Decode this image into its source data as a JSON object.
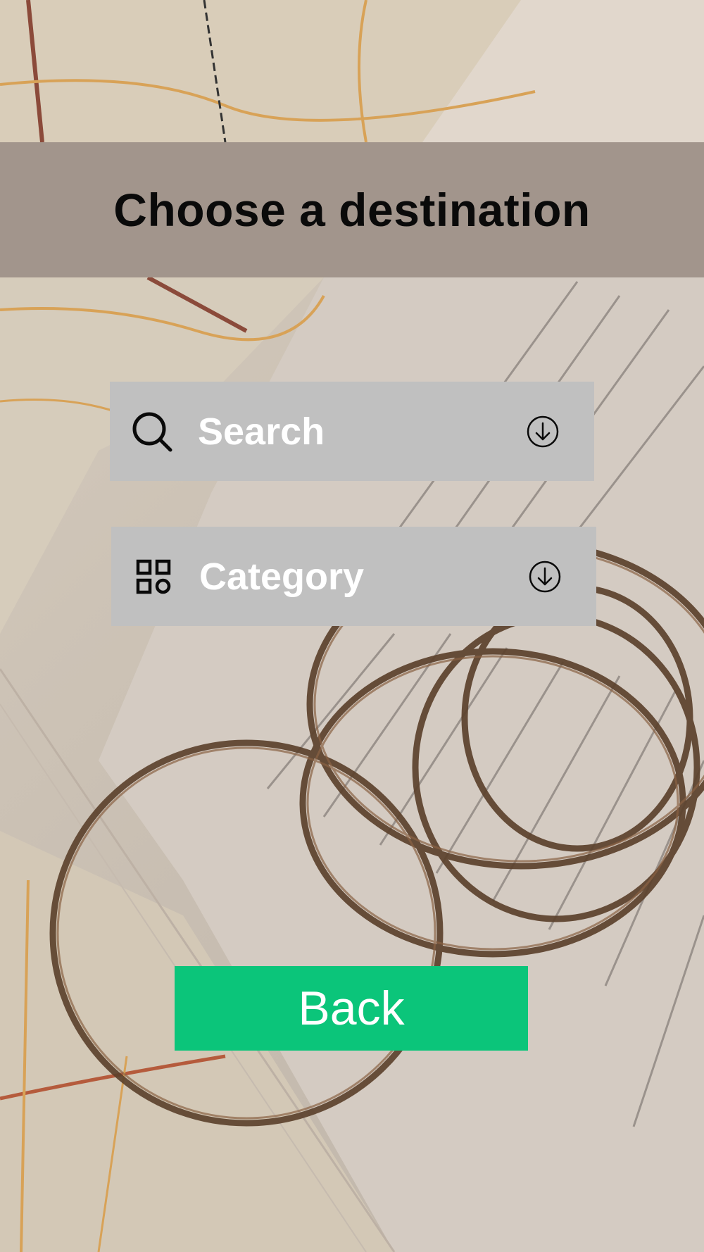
{
  "header": {
    "title": "Choose a destination"
  },
  "search": {
    "label": "Search",
    "lead_icon": "search-icon",
    "trail_icon": "arrow-down-circle-icon"
  },
  "category": {
    "label": "Category",
    "lead_icon": "category-grid-icon",
    "trail_icon": "arrow-down-circle-icon"
  },
  "back": {
    "label": "Back"
  },
  "colors": {
    "header_band": "#a2958c",
    "field_bg": "#c0c0c0",
    "field_text": "#ffffff",
    "back_button": "#0bc57a"
  }
}
